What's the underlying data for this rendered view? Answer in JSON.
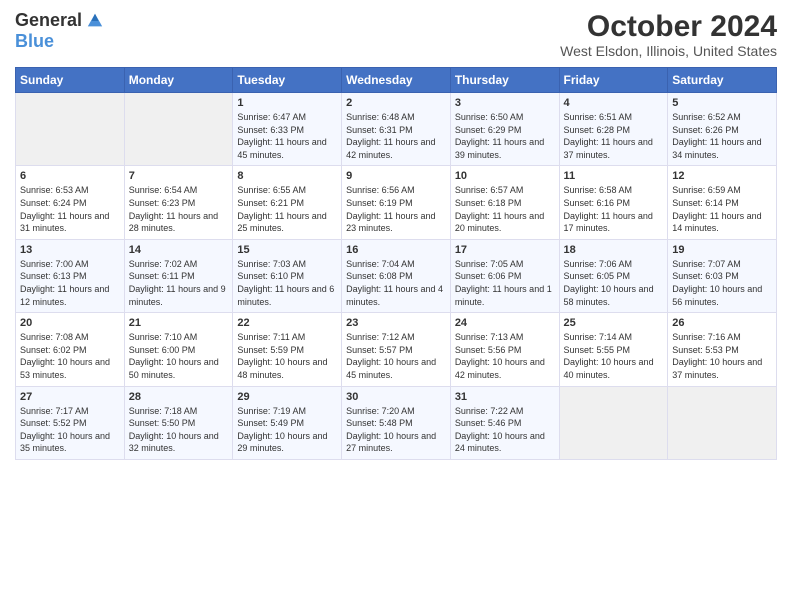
{
  "header": {
    "logo_general": "General",
    "logo_blue": "Blue",
    "title": "October 2024",
    "location": "West Elsdon, Illinois, United States"
  },
  "days_of_week": [
    "Sunday",
    "Monday",
    "Tuesday",
    "Wednesday",
    "Thursday",
    "Friday",
    "Saturday"
  ],
  "weeks": [
    [
      {
        "day": "",
        "sunrise": "",
        "sunset": "",
        "daylight": "",
        "empty": true
      },
      {
        "day": "",
        "sunrise": "",
        "sunset": "",
        "daylight": "",
        "empty": true
      },
      {
        "day": "1",
        "sunrise": "Sunrise: 6:47 AM",
        "sunset": "Sunset: 6:33 PM",
        "daylight": "Daylight: 11 hours and 45 minutes."
      },
      {
        "day": "2",
        "sunrise": "Sunrise: 6:48 AM",
        "sunset": "Sunset: 6:31 PM",
        "daylight": "Daylight: 11 hours and 42 minutes."
      },
      {
        "day": "3",
        "sunrise": "Sunrise: 6:50 AM",
        "sunset": "Sunset: 6:29 PM",
        "daylight": "Daylight: 11 hours and 39 minutes."
      },
      {
        "day": "4",
        "sunrise": "Sunrise: 6:51 AM",
        "sunset": "Sunset: 6:28 PM",
        "daylight": "Daylight: 11 hours and 37 minutes."
      },
      {
        "day": "5",
        "sunrise": "Sunrise: 6:52 AM",
        "sunset": "Sunset: 6:26 PM",
        "daylight": "Daylight: 11 hours and 34 minutes."
      }
    ],
    [
      {
        "day": "6",
        "sunrise": "Sunrise: 6:53 AM",
        "sunset": "Sunset: 6:24 PM",
        "daylight": "Daylight: 11 hours and 31 minutes."
      },
      {
        "day": "7",
        "sunrise": "Sunrise: 6:54 AM",
        "sunset": "Sunset: 6:23 PM",
        "daylight": "Daylight: 11 hours and 28 minutes."
      },
      {
        "day": "8",
        "sunrise": "Sunrise: 6:55 AM",
        "sunset": "Sunset: 6:21 PM",
        "daylight": "Daylight: 11 hours and 25 minutes."
      },
      {
        "day": "9",
        "sunrise": "Sunrise: 6:56 AM",
        "sunset": "Sunset: 6:19 PM",
        "daylight": "Daylight: 11 hours and 23 minutes."
      },
      {
        "day": "10",
        "sunrise": "Sunrise: 6:57 AM",
        "sunset": "Sunset: 6:18 PM",
        "daylight": "Daylight: 11 hours and 20 minutes."
      },
      {
        "day": "11",
        "sunrise": "Sunrise: 6:58 AM",
        "sunset": "Sunset: 6:16 PM",
        "daylight": "Daylight: 11 hours and 17 minutes."
      },
      {
        "day": "12",
        "sunrise": "Sunrise: 6:59 AM",
        "sunset": "Sunset: 6:14 PM",
        "daylight": "Daylight: 11 hours and 14 minutes."
      }
    ],
    [
      {
        "day": "13",
        "sunrise": "Sunrise: 7:00 AM",
        "sunset": "Sunset: 6:13 PM",
        "daylight": "Daylight: 11 hours and 12 minutes."
      },
      {
        "day": "14",
        "sunrise": "Sunrise: 7:02 AM",
        "sunset": "Sunset: 6:11 PM",
        "daylight": "Daylight: 11 hours and 9 minutes."
      },
      {
        "day": "15",
        "sunrise": "Sunrise: 7:03 AM",
        "sunset": "Sunset: 6:10 PM",
        "daylight": "Daylight: 11 hours and 6 minutes."
      },
      {
        "day": "16",
        "sunrise": "Sunrise: 7:04 AM",
        "sunset": "Sunset: 6:08 PM",
        "daylight": "Daylight: 11 hours and 4 minutes."
      },
      {
        "day": "17",
        "sunrise": "Sunrise: 7:05 AM",
        "sunset": "Sunset: 6:06 PM",
        "daylight": "Daylight: 11 hours and 1 minute."
      },
      {
        "day": "18",
        "sunrise": "Sunrise: 7:06 AM",
        "sunset": "Sunset: 6:05 PM",
        "daylight": "Daylight: 10 hours and 58 minutes."
      },
      {
        "day": "19",
        "sunrise": "Sunrise: 7:07 AM",
        "sunset": "Sunset: 6:03 PM",
        "daylight": "Daylight: 10 hours and 56 minutes."
      }
    ],
    [
      {
        "day": "20",
        "sunrise": "Sunrise: 7:08 AM",
        "sunset": "Sunset: 6:02 PM",
        "daylight": "Daylight: 10 hours and 53 minutes."
      },
      {
        "day": "21",
        "sunrise": "Sunrise: 7:10 AM",
        "sunset": "Sunset: 6:00 PM",
        "daylight": "Daylight: 10 hours and 50 minutes."
      },
      {
        "day": "22",
        "sunrise": "Sunrise: 7:11 AM",
        "sunset": "Sunset: 5:59 PM",
        "daylight": "Daylight: 10 hours and 48 minutes."
      },
      {
        "day": "23",
        "sunrise": "Sunrise: 7:12 AM",
        "sunset": "Sunset: 5:57 PM",
        "daylight": "Daylight: 10 hours and 45 minutes."
      },
      {
        "day": "24",
        "sunrise": "Sunrise: 7:13 AM",
        "sunset": "Sunset: 5:56 PM",
        "daylight": "Daylight: 10 hours and 42 minutes."
      },
      {
        "day": "25",
        "sunrise": "Sunrise: 7:14 AM",
        "sunset": "Sunset: 5:55 PM",
        "daylight": "Daylight: 10 hours and 40 minutes."
      },
      {
        "day": "26",
        "sunrise": "Sunrise: 7:16 AM",
        "sunset": "Sunset: 5:53 PM",
        "daylight": "Daylight: 10 hours and 37 minutes."
      }
    ],
    [
      {
        "day": "27",
        "sunrise": "Sunrise: 7:17 AM",
        "sunset": "Sunset: 5:52 PM",
        "daylight": "Daylight: 10 hours and 35 minutes."
      },
      {
        "day": "28",
        "sunrise": "Sunrise: 7:18 AM",
        "sunset": "Sunset: 5:50 PM",
        "daylight": "Daylight: 10 hours and 32 minutes."
      },
      {
        "day": "29",
        "sunrise": "Sunrise: 7:19 AM",
        "sunset": "Sunset: 5:49 PM",
        "daylight": "Daylight: 10 hours and 29 minutes."
      },
      {
        "day": "30",
        "sunrise": "Sunrise: 7:20 AM",
        "sunset": "Sunset: 5:48 PM",
        "daylight": "Daylight: 10 hours and 27 minutes."
      },
      {
        "day": "31",
        "sunrise": "Sunrise: 7:22 AM",
        "sunset": "Sunset: 5:46 PM",
        "daylight": "Daylight: 10 hours and 24 minutes."
      },
      {
        "day": "",
        "sunrise": "",
        "sunset": "",
        "daylight": "",
        "empty": true
      },
      {
        "day": "",
        "sunrise": "",
        "sunset": "",
        "daylight": "",
        "empty": true
      }
    ]
  ]
}
